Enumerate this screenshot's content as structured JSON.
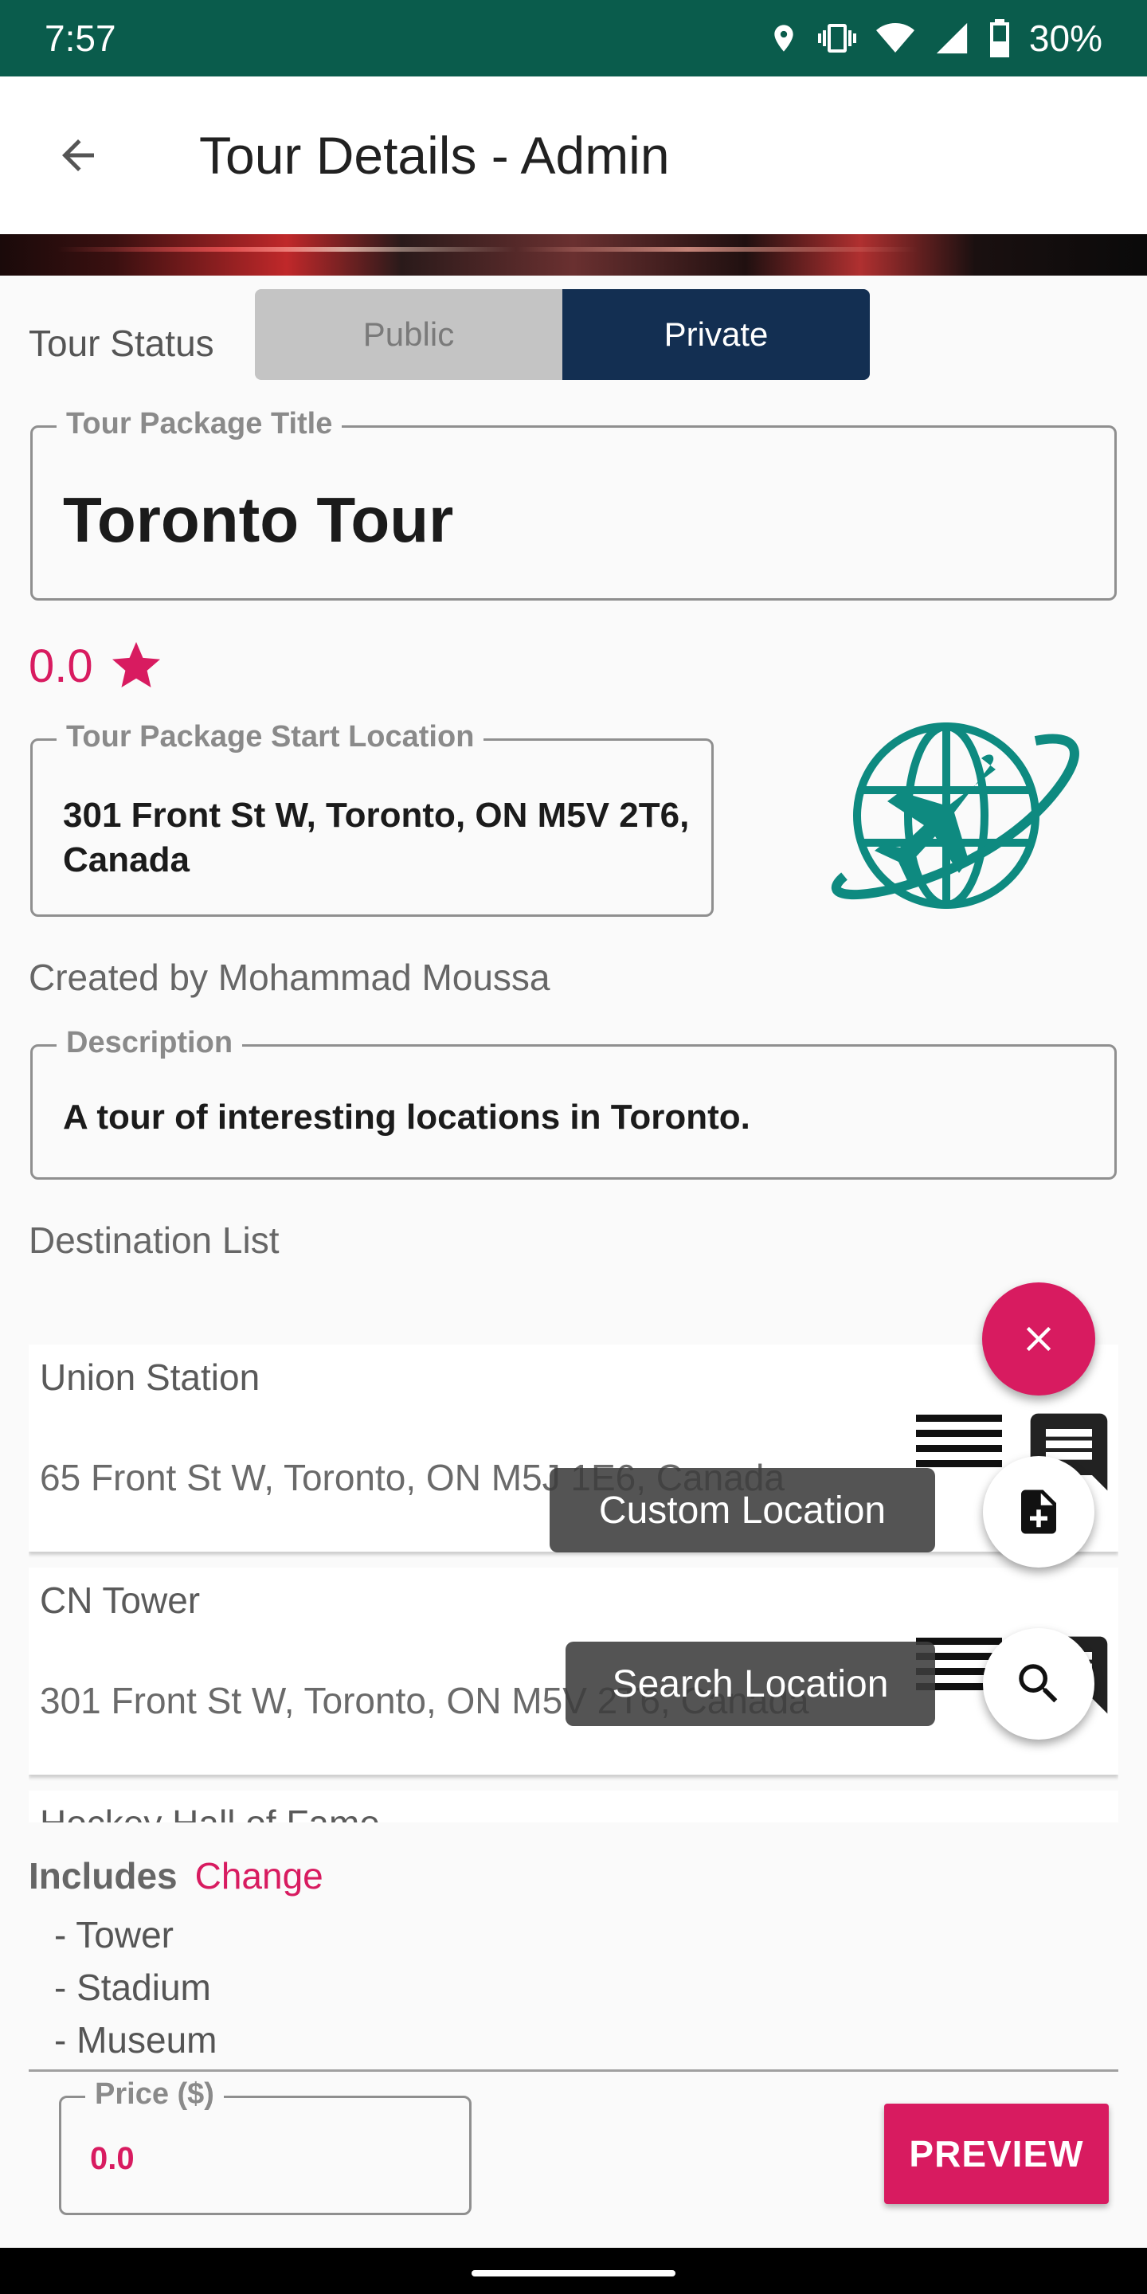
{
  "status_bar": {
    "time": "7:57",
    "battery": "30%",
    "icons": [
      "location-icon",
      "vibrate-icon",
      "wifi-icon",
      "signal-icon",
      "battery-icon"
    ]
  },
  "app_bar": {
    "title": "Tour Details - Admin",
    "back_icon": "arrow-back-icon"
  },
  "tour_status": {
    "label": "Tour Status",
    "options": [
      "Public",
      "Private"
    ],
    "selected": "Private"
  },
  "title_field": {
    "label": "Tour Package Title",
    "value": "Toronto Tour"
  },
  "rating": {
    "value": "0.0",
    "icon": "star-icon"
  },
  "start_location": {
    "label": "Tour Package Start Location",
    "value": "301 Front St W, Toronto, ON M5V 2T6, Canada"
  },
  "created_by": "Created by Mohammad Moussa",
  "description": {
    "label": "Description",
    "value": "A tour of interesting locations in Toronto."
  },
  "destination_list": {
    "label": "Destination List",
    "items": [
      {
        "name": "Union Station",
        "address": "65 Front St W, Toronto, ON M5J 1E6, Canada"
      },
      {
        "name": "CN Tower",
        "address": "301 Front St W, Toronto, ON M5V 2T6, Canada"
      },
      {
        "name": "Hockey Hall of Fame",
        "address": ""
      }
    ]
  },
  "speed_dial": {
    "close_icon": "close-icon",
    "actions": [
      {
        "label": "Custom Location",
        "icon": "note-add-icon"
      },
      {
        "label": "Search Location",
        "icon": "search-icon"
      }
    ]
  },
  "includes": {
    "title": "Includes",
    "change": "Change",
    "items": [
      "- Tower",
      "- Stadium",
      "- Museum"
    ]
  },
  "price": {
    "label": "Price ($)",
    "value": "0.0"
  },
  "preview_button": "PREVIEW",
  "colors": {
    "status_bar": "#0a5c4c",
    "accent": "#d81b60",
    "segment_selected": "#132f52",
    "segment_unselected": "#c4c4c4",
    "globe": "#0e8a80"
  }
}
